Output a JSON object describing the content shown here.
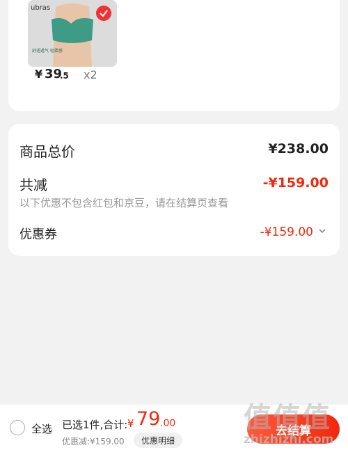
{
  "product": {
    "brand": "ubras",
    "tagline": "舒适透气 轻柔感",
    "price_symbol": "¥",
    "price_integer": "39",
    "price_decimal": ".5",
    "quantity": "x2",
    "icons": {
      "selected": "check-circle-icon"
    }
  },
  "summary": {
    "total_label": "商品总价",
    "total_value": "¥238.00",
    "reduction_label": "共减",
    "reduction_value": "-¥159.00",
    "note": "以下优惠不包含红包和京豆，请在结算页查看",
    "coupon_label": "优惠券",
    "coupon_value": "-¥159.00"
  },
  "bottom": {
    "select_all": "全选",
    "selected_info": "已选1件,合计:",
    "total_symbol": "¥",
    "total_integer": "79",
    "total_decimal": ".00",
    "discount": "优惠减:¥159.00",
    "detail_button": "优惠明细",
    "checkout_button": "去结算"
  },
  "watermark": {
    "main": "值值值",
    "sub": "zhizhizhi.com"
  },
  "colors": {
    "accent": "#f2270c",
    "background": "#f2f2f2",
    "card": "#ffffff"
  }
}
